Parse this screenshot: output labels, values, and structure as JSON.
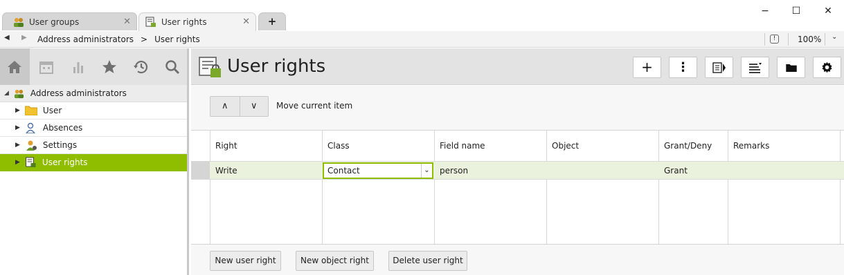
{
  "tabs": [
    {
      "label": "User groups",
      "icon": "user-group-icon",
      "active": false
    },
    {
      "label": "User rights",
      "icon": "user-rights-icon",
      "active": true
    }
  ],
  "new_tab_label": "+",
  "window_controls": {
    "minimize": "−",
    "maximize": "☐",
    "close": "✕"
  },
  "breadcrumb": [
    "Address administrators",
    ">",
    "User rights"
  ],
  "zoom": "100%",
  "sidebar": {
    "icons": [
      "home-icon",
      "calendar-icon",
      "chart-icon",
      "star-icon",
      "history-icon",
      "search-icon"
    ],
    "tree_root": "Address administrators",
    "items": [
      {
        "label": "User",
        "icon": "folder-icon"
      },
      {
        "label": "Absences",
        "icon": "absence-icon"
      },
      {
        "label": "Settings",
        "icon": "settings-user-icon"
      },
      {
        "label": "User rights",
        "icon": "user-rights-icon",
        "selected": true
      }
    ]
  },
  "main": {
    "title": "User rights",
    "move_label": "Move current item",
    "columns": [
      "Right",
      "Class",
      "Field name",
      "Object",
      "Grant/Deny",
      "Remarks"
    ],
    "rows": [
      {
        "right": "Write",
        "class": "Contact",
        "field_name": "person",
        "object": "",
        "grant_deny": "Grant",
        "remarks": ""
      }
    ],
    "buttons": {
      "new_user_right": "New user right",
      "new_object_right": "New object right",
      "delete_user_right": "Delete user right"
    }
  },
  "colors": {
    "accent": "#8fbd00",
    "row_highlight": "#eaf1dd"
  }
}
